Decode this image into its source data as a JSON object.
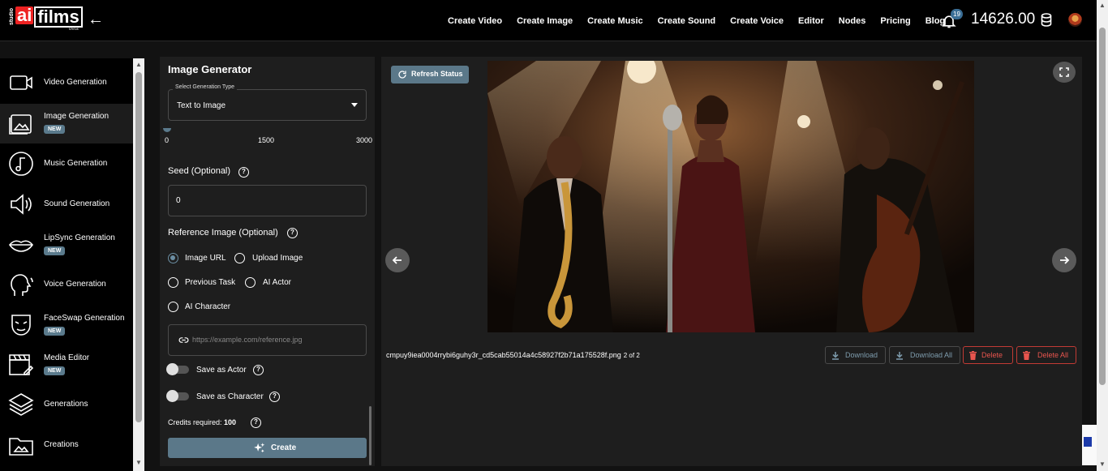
{
  "app": {
    "logo_studio": "studio",
    "logo_ai": "ai",
    "logo_films": "films",
    "logo_beta": "beta"
  },
  "header": {
    "nav": [
      "Create Video",
      "Create Image",
      "Create Music",
      "Create Sound",
      "Create Voice",
      "Editor",
      "Nodes",
      "Pricing",
      "Blog"
    ],
    "notification_count": "19",
    "credits": "14626.00"
  },
  "sidebar": {
    "items": [
      {
        "label": "Video Generation",
        "icon": "video-icon",
        "new": false
      },
      {
        "label": "Image Generation",
        "icon": "image-icon",
        "new": true,
        "active": true
      },
      {
        "label": "Music Generation",
        "icon": "music-note-icon",
        "new": false
      },
      {
        "label": "Sound Generation",
        "icon": "speaker-icon",
        "new": false
      },
      {
        "label": "LipSync Generation",
        "icon": "lips-icon",
        "new": true
      },
      {
        "label": "Voice Generation",
        "icon": "voice-head-icon",
        "new": false
      },
      {
        "label": "FaceSwap Generation",
        "icon": "mask-icon",
        "new": true
      },
      {
        "label": "Media Editor",
        "icon": "clapper-edit-icon",
        "new": true
      },
      {
        "label": "Generations",
        "icon": "layers-icon",
        "new": false
      },
      {
        "label": "Creations",
        "icon": "folder-image-icon",
        "new": false
      }
    ],
    "new_badge": "NEW"
  },
  "generator": {
    "title": "Image Generator",
    "type_label": "Select Generation Type",
    "type_value": "Text to Image",
    "slider_ticks": [
      "0",
      "1500",
      "3000"
    ],
    "seed_label": "Seed (Optional)",
    "seed_value": "0",
    "reference_label": "Reference Image (Optional)",
    "reference_options": [
      {
        "label": "Image URL",
        "checked": true
      },
      {
        "label": "Upload Image",
        "checked": false
      },
      {
        "label": "Previous Task",
        "checked": false
      },
      {
        "label": "AI Actor",
        "checked": false
      },
      {
        "label": "AI Character",
        "checked": false
      }
    ],
    "url_placeholder": "https://example.com/reference.jpg",
    "save_actor_label": "Save as Actor",
    "save_character_label": "Save as Character",
    "credits_label": "Credits required:",
    "credits_value": "100",
    "create_label": "Create"
  },
  "viewer": {
    "refresh_label": "Refresh Status",
    "filename": "cmpuy9iea0004rrybi6guhy3r_cd5cab55014a4c58927f2b71a175528f.png",
    "count": "2 of 2",
    "download_label": "Download",
    "download_all_label": "Download All",
    "delete_label": "Delete",
    "delete_all_label": "Delete All",
    "image_description": "jazz trio on stage"
  },
  "colors": {
    "accent": "#5b7889",
    "delete": "#e8554e",
    "background": "#121212",
    "panel": "#1e1e1e"
  }
}
